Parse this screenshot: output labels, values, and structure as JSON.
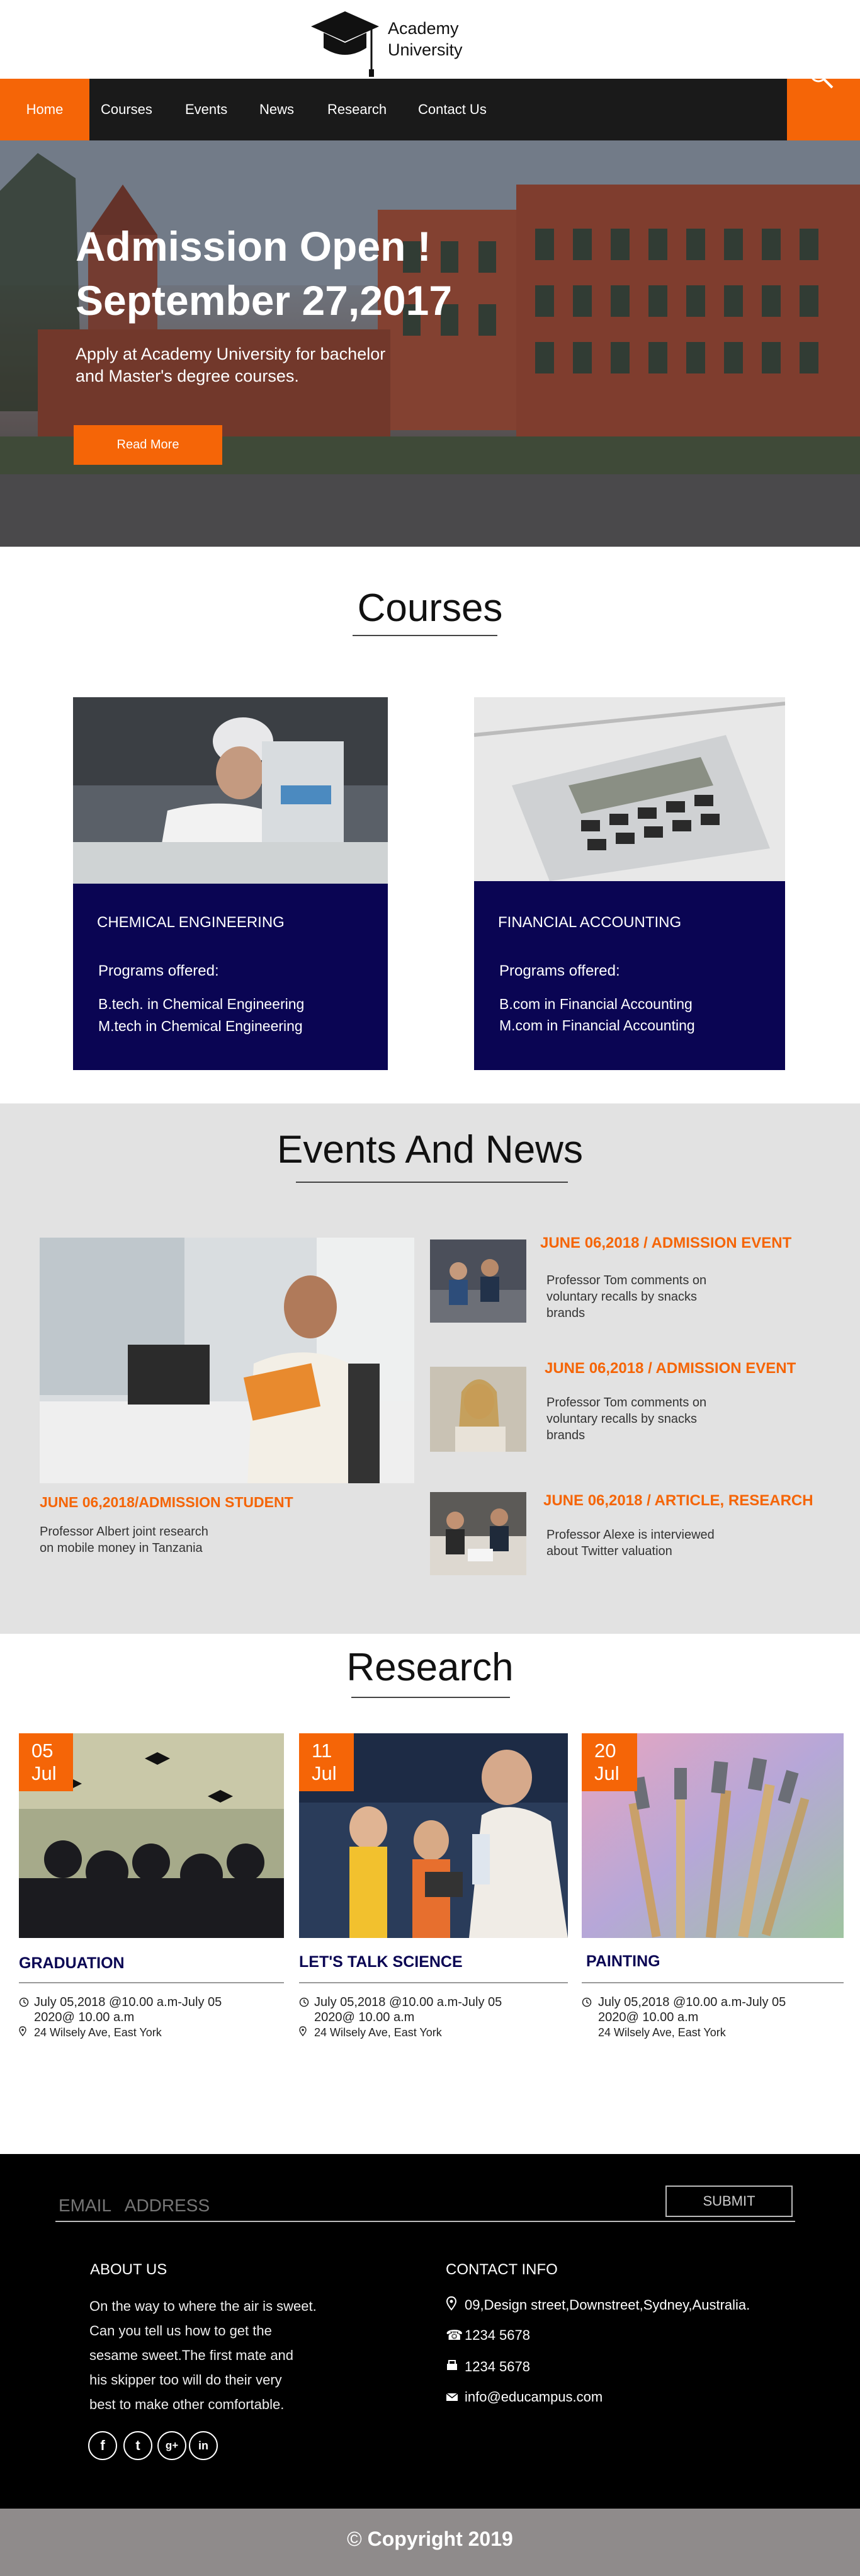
{
  "header": {
    "logo_line1": "Academy",
    "logo_line2": "University"
  },
  "nav": {
    "items": [
      "Home",
      "Courses",
      "Events",
      "News",
      "Research",
      "Contact Us"
    ],
    "active": "Home",
    "search_icon": "search-icon"
  },
  "hero": {
    "title_line1": "Admission Open !",
    "title_line2": "September 27,2017",
    "subtitle_line1": "Apply at Academy University for bachelor",
    "subtitle_line2": "and Master's degree courses.",
    "button": "Read More"
  },
  "courses": {
    "title": "Courses",
    "items": [
      {
        "name": "CHEMICAL ENGINEERING",
        "programs_label": "Programs offered:",
        "program1": "B.tech. in Chemical Engineering",
        "program2": "M.tech in Chemical Engineering"
      },
      {
        "name": "FINANCIAL ACCOUNTING",
        "programs_label": "Programs offered:",
        "program1": "B.com in Financial Accounting",
        "program2": "M.com in Financial Accounting"
      }
    ]
  },
  "events": {
    "title": "Events And News",
    "featured": {
      "title": "JUNE 06,2018/ADMISSION STUDENT",
      "text_line1": "Professor Albert joint research",
      "text_line2": "on mobile money in Tanzania"
    },
    "items": [
      {
        "title": "JUNE 06,2018 / ADMISSION EVENT",
        "l1": "Professor Tom comments on",
        "l2": "voluntary recalls by snacks",
        "l3": "brands"
      },
      {
        "title": "JUNE 06,2018 / ADMISSION EVENT",
        "l1": "Professor Tom comments on",
        "l2": "voluntary recalls by snacks",
        "l3": "brands"
      },
      {
        "title": "JUNE 06,2018 / ARTICLE, RESEARCH",
        "l1": "Professor Alexe is interviewed",
        "l2": "about Twitter valuation",
        "l3": ""
      }
    ]
  },
  "research": {
    "title": "Research",
    "cards": [
      {
        "day": "05",
        "month": "Jul",
        "title": "GRADUATION",
        "time_l1": "July 05,2018 @10.00 a.m-July 05",
        "time_l2": "2020@ 10.00 a.m",
        "address": "24 Wilsely Ave, East York"
      },
      {
        "day": "11",
        "month": "Jul",
        "title": "LET'S TALK SCIENCE",
        "time_l1": "July 05,2018 @10.00 a.m-July 05",
        "time_l2": "2020@ 10.00 a.m",
        "address": "24 Wilsely Ave, East York"
      },
      {
        "day": "20",
        "month": "Jul",
        "title": "PAINTING",
        "time_l1": "July 05,2018 @10.00 a.m-July 05",
        "time_l2": "2020@ 10.00 a.m",
        "address": "24 Wilsely Ave, East York"
      }
    ]
  },
  "footer": {
    "email_placeholder": "EMAIL   ADDRESS",
    "submit": "SUBMIT",
    "about_title": "ABOUT US",
    "about_lines": [
      "On the way to where the air is sweet.",
      "Can you tell us how to get the",
      "sesame sweet.The first mate and",
      "his skipper too will do their very",
      "best to make other comfortable."
    ],
    "contact_title": "CONTACT INFO",
    "address": "09,Design street,Downstreet,Sydney,Australia.",
    "phone": "1234 5678",
    "fax": "1234 5678",
    "email": "info@educampus.com",
    "social": [
      "f",
      "t",
      "g+",
      "in"
    ]
  },
  "copyright": "Copyright 2019",
  "colors": {
    "accent": "#f56507",
    "navy": "#0a0553",
    "nav_bg": "#1a1a1a",
    "events_bg": "#e2e2e2",
    "footer_bg": "#000000",
    "copyright_bg": "#8f8b8b"
  }
}
